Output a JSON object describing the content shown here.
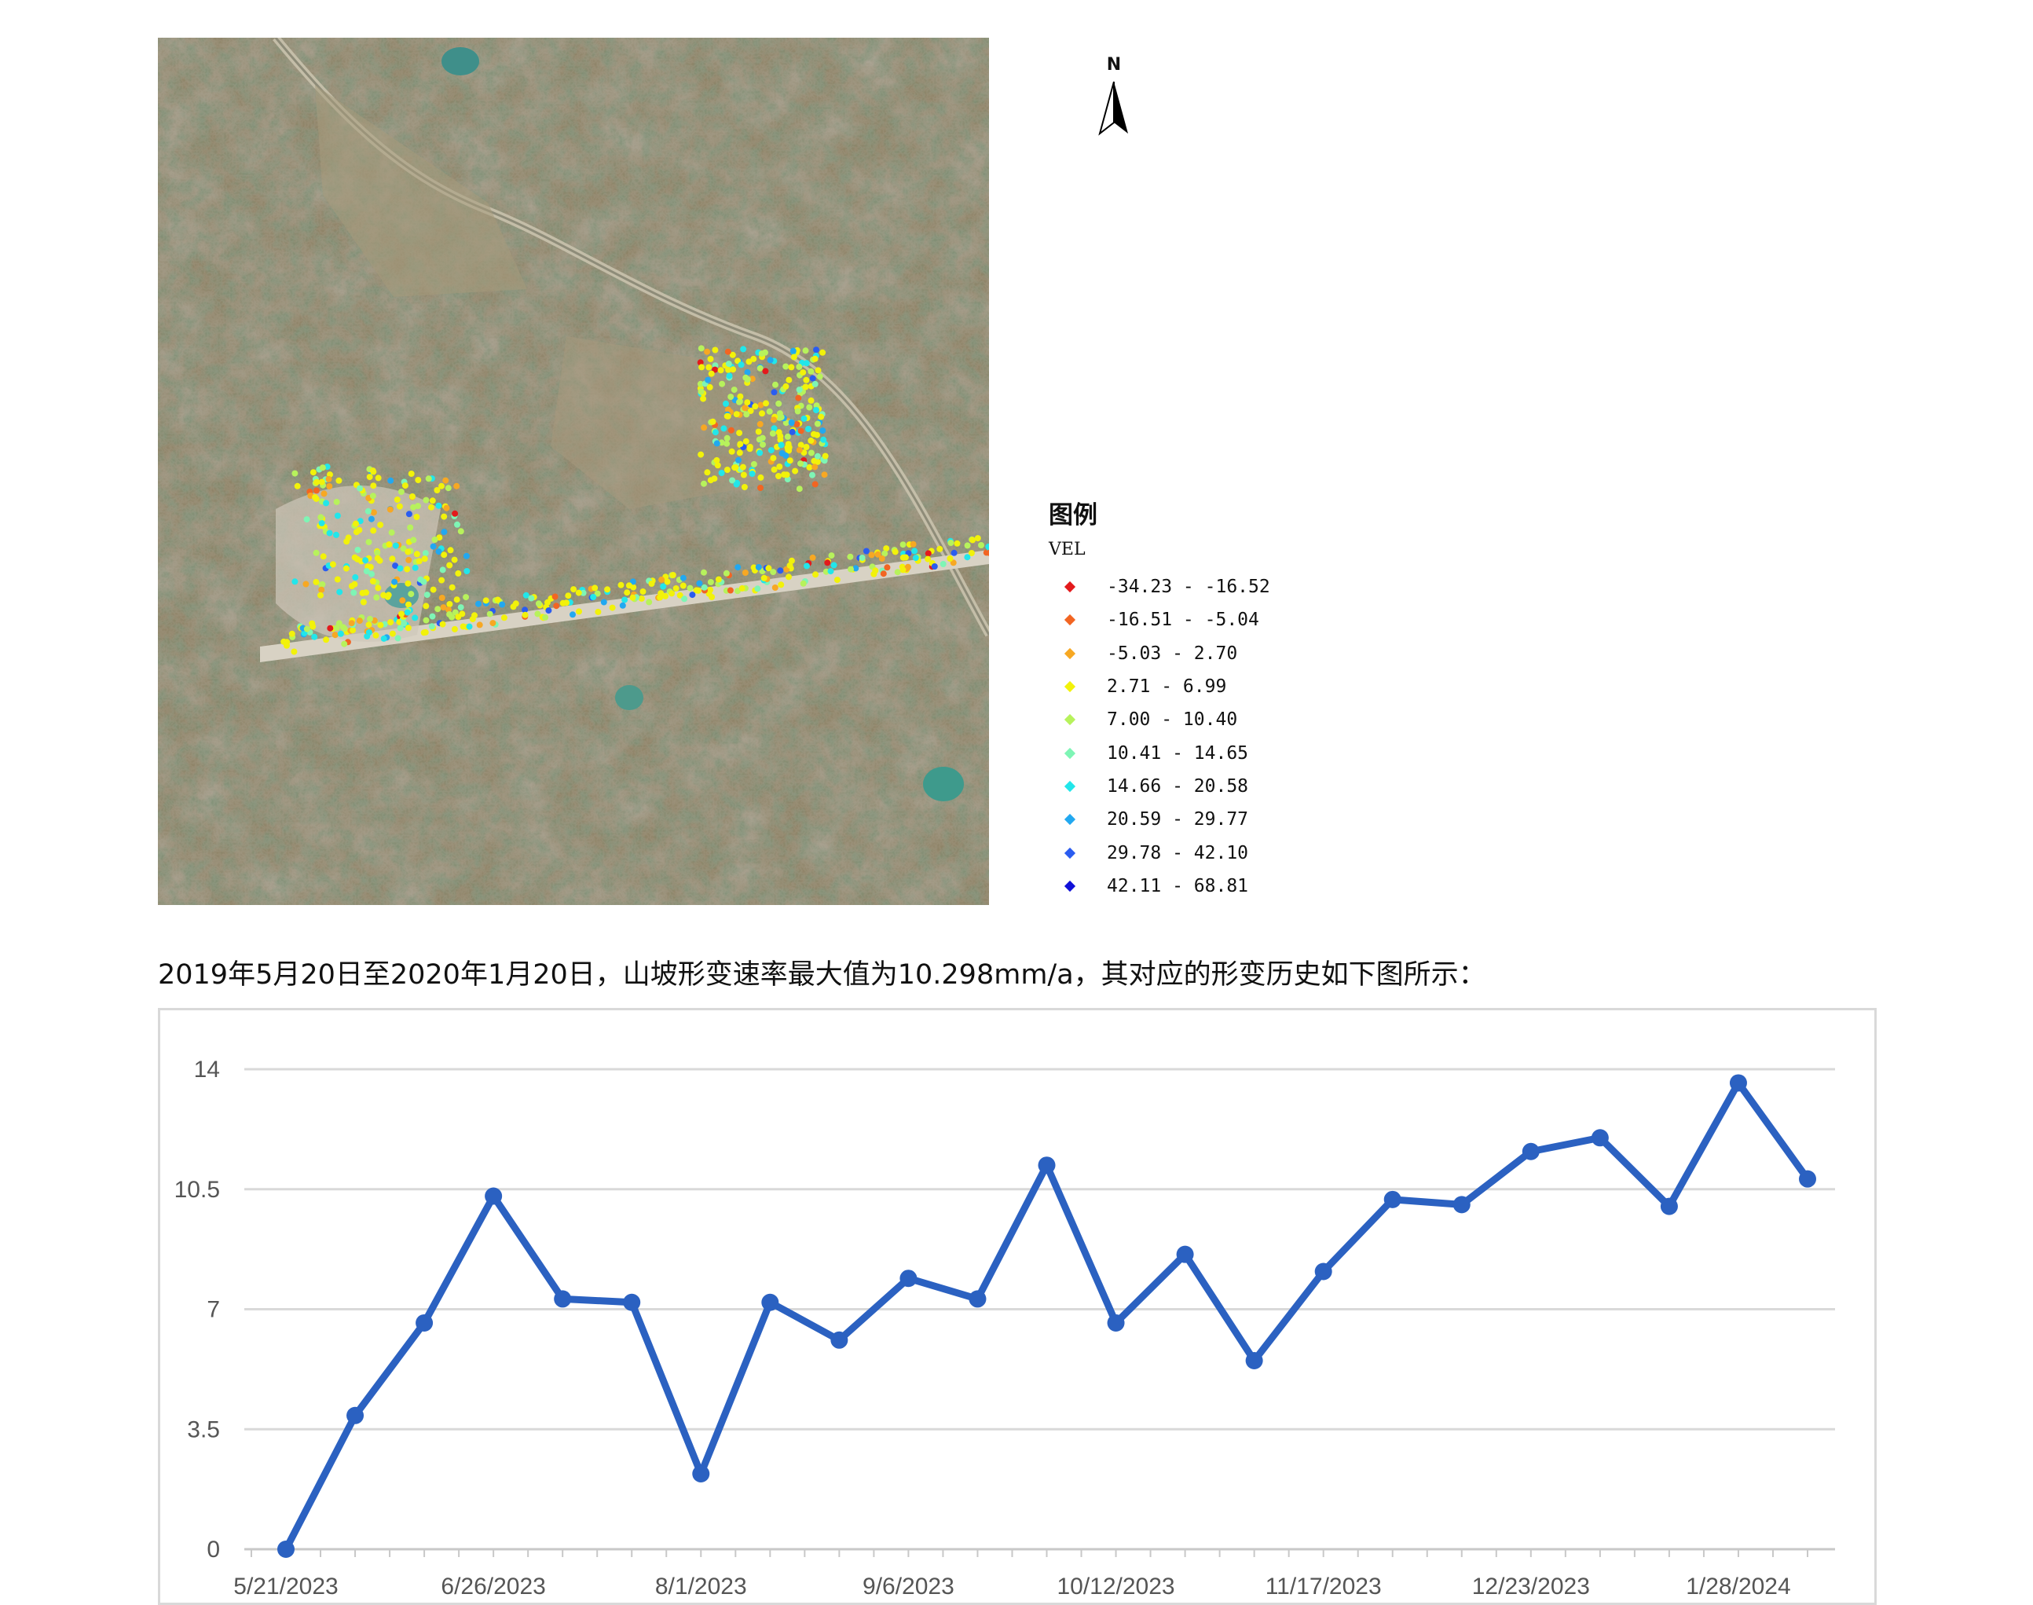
{
  "north_arrow": {
    "letter": "N",
    "icon": "north-arrow-icon"
  },
  "legend": {
    "title": "图例",
    "field": "VEL",
    "items": [
      {
        "label": "-34.23 - -16.52",
        "color": "#e31a1c"
      },
      {
        "label": "-16.51 - -5.04",
        "color": "#f26522"
      },
      {
        "label": "-5.03 - 2.70",
        "color": "#f7a823"
      },
      {
        "label": "2.71 - 6.99",
        "color": "#f2f20a"
      },
      {
        "label": "7.00 - 10.40",
        "color": "#b7f25c"
      },
      {
        "label": "10.41 - 14.65",
        "color": "#7ef5b5"
      },
      {
        "label": "14.66 - 20.58",
        "color": "#22e6ea"
      },
      {
        "label": "20.59 - 29.77",
        "color": "#22a8f0"
      },
      {
        "label": "29.78 - 42.10",
        "color": "#2a5cf0"
      },
      {
        "label": "42.11 - 68.81",
        "color": "#1010d8"
      }
    ]
  },
  "caption": "2019年5月20日至2020年1月20日，山坡形变速率最大值为10.298mm/a，其对应的形变历史如下图所示：",
  "chart_data": {
    "type": "line",
    "x": [
      "5/21/2023",
      "6/2/2023",
      "6/14/2023",
      "6/26/2023",
      "7/8/2023",
      "7/20/2023",
      "8/1/2023",
      "8/13/2023",
      "8/25/2023",
      "9/6/2023",
      "9/18/2023",
      "9/30/2023",
      "10/12/2023",
      "10/24/2023",
      "11/5/2023",
      "11/17/2023",
      "11/29/2023",
      "12/11/2023",
      "12/23/2023",
      "1/4/2024",
      "1/16/2024",
      "1/28/2024",
      "2/9/2024"
    ],
    "values": [
      0,
      3.9,
      6.6,
      10.3,
      7.3,
      7.2,
      2.2,
      7.2,
      6.1,
      7.9,
      7.3,
      11.2,
      6.6,
      8.6,
      5.5,
      8.1,
      10.2,
      10.05,
      11.6,
      12.0,
      10.0,
      13.6,
      10.8
    ],
    "xtick_labels": [
      "5/21/2023",
      "6/26/2023",
      "8/1/2023",
      "9/6/2023",
      "10/12/2023",
      "11/17/2023",
      "12/23/2023",
      "1/28/2024"
    ],
    "yticks": [
      "0",
      "3.5",
      "7",
      "10.5",
      "14"
    ],
    "ylim": [
      0,
      14
    ],
    "grid": true,
    "line_color": "#2b61c1",
    "title": "",
    "xlabel": "",
    "ylabel": ""
  }
}
